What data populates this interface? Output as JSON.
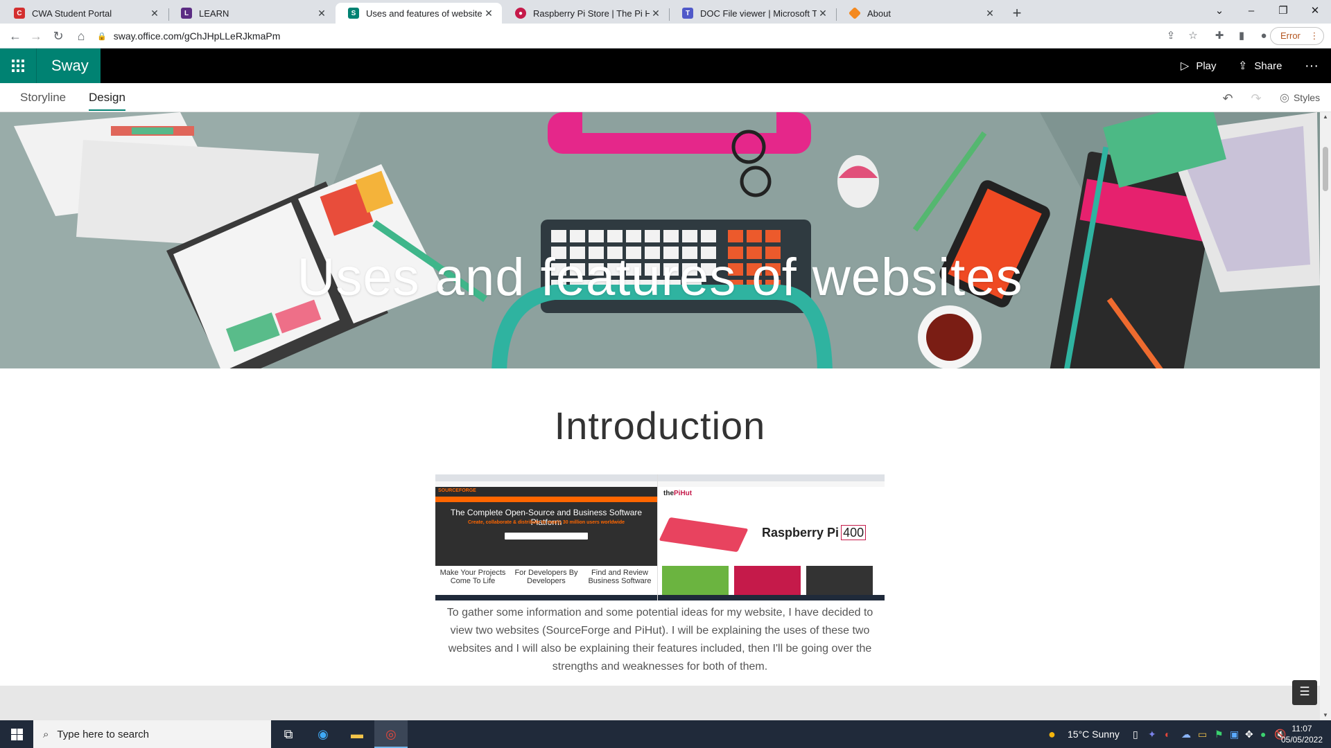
{
  "browser": {
    "tabs": [
      {
        "title": "CWA Student Portal",
        "icon": "cwa-portal-icon",
        "color": "#d32f2f"
      },
      {
        "title": "LEARN",
        "icon": "learn-icon",
        "color": "#5b2c83"
      },
      {
        "title": "Uses and features of websites",
        "icon": "sway-icon",
        "color": "#008272",
        "active": true
      },
      {
        "title": "Raspberry Pi Store | The Pi Hut",
        "icon": "raspberry-icon",
        "color": "#c51a4a"
      },
      {
        "title": "DOC File viewer | Microsoft Team",
        "icon": "teams-icon",
        "color": "#5059c9"
      },
      {
        "title": "About",
        "icon": "about-icon",
        "color": "#f4891f"
      }
    ],
    "url": "sway.office.com/gChJHpLLeRJkmaPm",
    "profile_status": "Error"
  },
  "sway": {
    "brand": "Sway",
    "play_label": "Play",
    "share_label": "Share",
    "tabs": {
      "storyline": "Storyline",
      "design": "Design"
    },
    "styles_label": "Styles"
  },
  "document": {
    "title": "Uses and features of websites",
    "intro_heading": "Introduction",
    "intro_text": "To gather some information and some potential ideas for my website, I have decided to view two websites (SourceForge and PiHut). I will be explaining the uses of these two websites and I will also be explaining their features included, then I'll be going over the strengths and weaknesses for both of them.",
    "screenshot_sourceforge": {
      "logo": "SOURCEFORGE",
      "headline": "The Complete Open-Source and Business Software Platform",
      "subline": "Create, collaborate & distribute to nearly 30 million users worldwide",
      "columns": [
        "Make Your Projects Come To Life",
        "For Developers By Developers",
        "Find and Review Business Software"
      ]
    },
    "screenshot_pihut": {
      "logo_prefix": "the",
      "logo_name": "PiHut",
      "product": "Raspberry Pi",
      "product_model": "400"
    }
  },
  "taskbar": {
    "search_placeholder": "Type here to search",
    "weather": "15°C  Sunny",
    "time": "11:07",
    "date": "05/05/2022"
  }
}
